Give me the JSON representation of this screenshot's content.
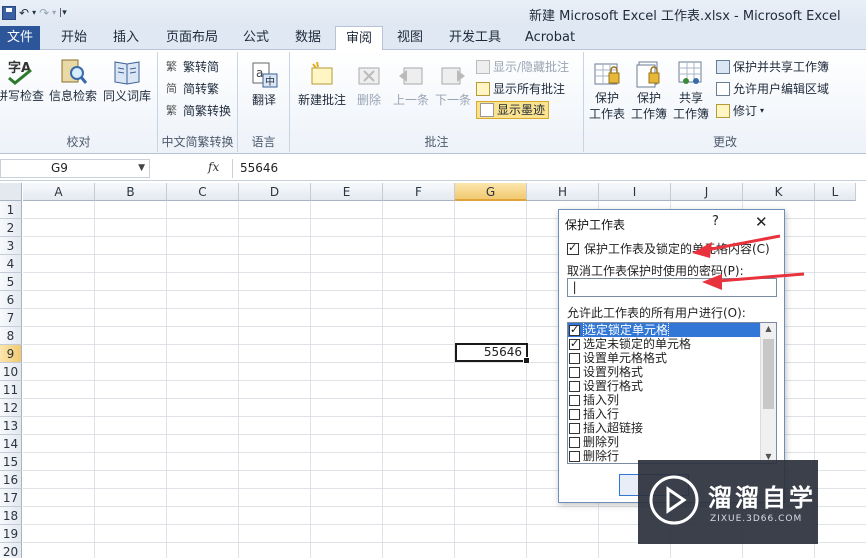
{
  "window": {
    "title": "新建 Microsoft Excel 工作表.xlsx - Microsoft Excel"
  },
  "tabs": [
    {
      "label": "文件",
      "kind": "file"
    },
    {
      "label": "开始"
    },
    {
      "label": "插入"
    },
    {
      "label": "页面布局"
    },
    {
      "label": "公式"
    },
    {
      "label": "数据"
    },
    {
      "label": "审阅",
      "active": true
    },
    {
      "label": "视图"
    },
    {
      "label": "开发工具"
    },
    {
      "label": "Acrobat"
    }
  ],
  "ribbon": {
    "proofing": {
      "label": "校对",
      "spelling": "拼写检查",
      "research": "信息检索",
      "thesaurus": "同义词库"
    },
    "chinese_conversion": {
      "label": "中文简繁转换",
      "to_simplified": "繁转简",
      "to_traditional": "简转繁",
      "convert": "简繁转换"
    },
    "language": {
      "label": "语言",
      "translate": "翻译"
    },
    "comments": {
      "label": "批注",
      "new": "新建批注",
      "delete": "删除",
      "previous": "上一条",
      "next": "下一条",
      "show_hide": "显示/隐藏批注",
      "show_all": "显示所有批注",
      "show_ink": "显示墨迹"
    },
    "changes": {
      "label": "更改",
      "protect_sheet_1": "保护",
      "protect_sheet_2": "工作表",
      "protect_workbook_1": "保护",
      "protect_workbook_2": "工作簿",
      "share_workbook_1": "共享",
      "share_workbook_2": "工作簿",
      "protect_share": "保护并共享工作簿",
      "allow_edit_ranges": "允许用户编辑区域",
      "track_changes": "修订"
    }
  },
  "formula_bar": {
    "name_box": "G9",
    "fx": "fx",
    "value": "55646"
  },
  "grid": {
    "columns": [
      "A",
      "B",
      "C",
      "D",
      "E",
      "F",
      "G",
      "H",
      "I",
      "J",
      "K",
      "L"
    ],
    "selected_column": "G",
    "rows": [
      "1",
      "2",
      "3",
      "4",
      "5",
      "6",
      "7",
      "8",
      "9",
      "10",
      "11",
      "12",
      "13",
      "14",
      "15",
      "16",
      "17",
      "18",
      "19",
      "20"
    ],
    "selected_row": "9",
    "active_cell": {
      "ref": "G9",
      "value": "55646"
    }
  },
  "dialog": {
    "title": "保护工作表",
    "help": "?",
    "close": "✕",
    "protect_option": "保护工作表及锁定的单元格内容(C)",
    "protect_checked": true,
    "password_label": "取消工作表保护时使用的密码(P):",
    "password_value": "",
    "allow_label": "允许此工作表的所有用户进行(O):",
    "permissions": [
      {
        "label": "选定锁定单元格",
        "checked": true,
        "selected": true
      },
      {
        "label": "选定未锁定的单元格",
        "checked": true
      },
      {
        "label": "设置单元格格式",
        "checked": false
      },
      {
        "label": "设置列格式",
        "checked": false
      },
      {
        "label": "设置行格式",
        "checked": false
      },
      {
        "label": "插入列",
        "checked": false
      },
      {
        "label": "插入行",
        "checked": false
      },
      {
        "label": "插入超链接",
        "checked": false
      },
      {
        "label": "删除列",
        "checked": false
      },
      {
        "label": "删除行",
        "checked": false
      }
    ]
  },
  "watermark": {
    "text": "溜溜自学",
    "url": "ZIXUE.3D66.COM"
  },
  "colors": {
    "accent": "#2c5699",
    "selection": "#3277d6",
    "arrow": "#e8323c",
    "header_highlight": "#f2c970"
  }
}
